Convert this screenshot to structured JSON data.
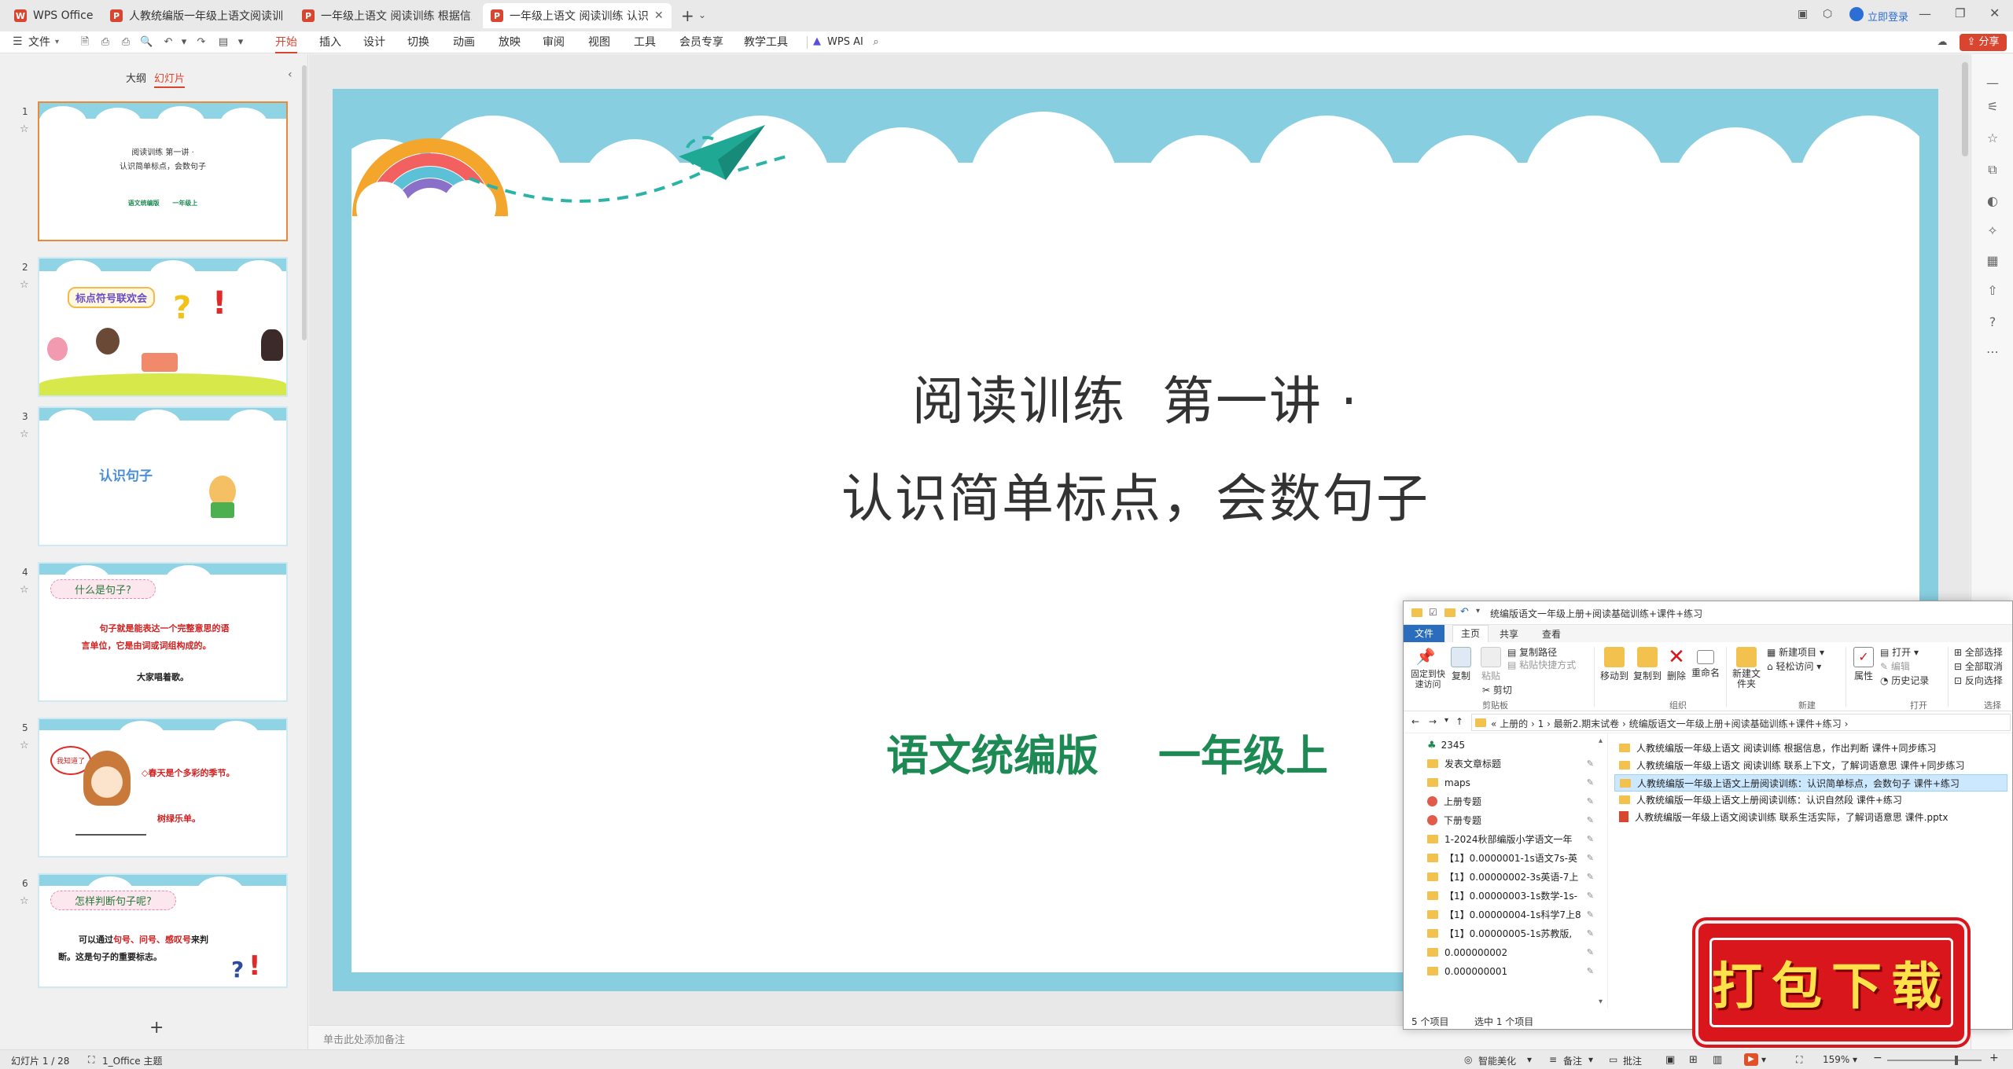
{
  "tabs": [
    {
      "label": "WPS Office",
      "icon": "wps-logo-icon"
    },
    {
      "label": "人教统编版一年级上语文阅读训练 联",
      "icon": "ppt-icon"
    },
    {
      "label": "一年级上语文 阅读训练 根据信息，作",
      "icon": "ppt-icon"
    },
    {
      "label": "一年级上语文 阅读训练 认识简",
      "icon": "ppt-icon"
    }
  ],
  "tabbar": {
    "new_tab": "+",
    "login": "立即登录"
  },
  "menubar": {
    "file": "文件",
    "items": [
      "开始",
      "插入",
      "设计",
      "切换",
      "动画",
      "放映",
      "审阅",
      "视图",
      "工具",
      "会员专享",
      "教学工具"
    ],
    "wps_ai": "WPS AI",
    "share": "分享"
  },
  "panel": {
    "outline_tab": "大纲",
    "slides_tab": "幻灯片",
    "add": "+"
  },
  "thumbnails": [
    {
      "num": "1",
      "line1": "阅读训练  第一讲 ·",
      "line2": "认识简单标点，会数句子",
      "green": "语文统编版      一年级上"
    },
    {
      "num": "2",
      "title": "标点符号联欢会"
    },
    {
      "num": "3",
      "title": "认识句子"
    },
    {
      "num": "4",
      "bubble": "什么是句子?",
      "body1": "句子就是能表达一个完整意思的语",
      "body2": "言单位，它是由词或词组构成的。",
      "example": "大家唱着歌。"
    },
    {
      "num": "5",
      "bubble": "我知道了",
      "body1": "◇春天是个多彩的季节。",
      "example": "树绿乐单。"
    },
    {
      "num": "6",
      "bubble": "怎样判断句子呢?",
      "body1a": "可以通过",
      "body1b": "句号、问号、感叹号",
      "body1c": "来判",
      "body2": "断。这是句子的重要标志。"
    }
  ],
  "slide": {
    "title1": "阅读训练  第一讲 ·",
    "title2": "认识简单标点，会数句子",
    "edition": "语文统编版",
    "grade": "一年级上"
  },
  "notes_placeholder": "单击此处添加备注",
  "status": {
    "slide_counter": "幻灯片 1 / 28",
    "theme": "1_Office 主题",
    "beautify": "智能美化",
    "notes": "备注",
    "comments": "批注",
    "zoom": "159%"
  },
  "explorer": {
    "title": "统编版语文一年级上册+阅读基础训练+课件+练习",
    "tabs": [
      "文件",
      "主页",
      "共享",
      "查看"
    ],
    "ribbon": {
      "pin": "固定到快速访问",
      "copy": "复制",
      "paste": "粘贴",
      "copy_path": "复制路径",
      "paste_shortcut": "粘贴快捷方式",
      "cut": "剪切",
      "move_to": "移动到",
      "copy_to": "复制到",
      "delete": "删除",
      "rename": "重命名",
      "new_folder": "新建文件夹",
      "new_item": "新建项目",
      "easy_access": "轻松访问",
      "properties": "属性",
      "open": "打开",
      "edit": "编辑",
      "history": "历史记录",
      "select_all": "全部选择",
      "select_none": "全部取消",
      "invert": "反向选择",
      "group_clipboard": "剪贴板",
      "group_organize": "组织",
      "group_new": "新建",
      "group_open": "打开",
      "group_select": "选择"
    },
    "address": [
      "上册的",
      "1",
      "最新2.期末试卷",
      "统编版语文一年级上册+阅读基础训练+课件+练习"
    ],
    "nav": [
      {
        "label": "2345",
        "type": "green"
      },
      {
        "label": "发表文章标题",
        "type": "folder"
      },
      {
        "label": "maps",
        "type": "folder"
      },
      {
        "label": "上册专题",
        "type": "red"
      },
      {
        "label": "下册专题",
        "type": "red"
      },
      {
        "label": "1-2024秋部编版小学语文一年",
        "type": "folder"
      },
      {
        "label": "【1】0.0000001-1s语文7s-英",
        "type": "folder"
      },
      {
        "label": "【1】0.00000002-3s英语-7上",
        "type": "folder"
      },
      {
        "label": "【1】0.00000003-1s数学-1s-",
        "type": "folder"
      },
      {
        "label": "【1】0.00000004-1s科学7上8",
        "type": "folder"
      },
      {
        "label": "【1】0.00000005-1s苏教版,",
        "type": "folder"
      },
      {
        "label": "0.000000002",
        "type": "folder"
      },
      {
        "label": "0.000000001",
        "type": "folder"
      }
    ],
    "files": [
      {
        "name": "人教统编版一年级上语文 阅读训练 根据信息，作出判断   课件+同步练习",
        "type": "folder"
      },
      {
        "name": "人教统编版一年级上语文 阅读训练 联系上下文，了解词语意思   课件+同步练习",
        "type": "folder"
      },
      {
        "name": "人教统编版一年级上语文上册阅读训练：认识简单标点，会数句子  课件+练习",
        "type": "folder",
        "selected": true
      },
      {
        "name": "人教统编版一年级上语文上册阅读训练：认识自然段  课件+练习",
        "type": "folder"
      },
      {
        "name": "人教统编版一年级上语文阅读训练 联系生活实际，了解词语意思  课件.pptx",
        "type": "pptx"
      }
    ],
    "status_count": "5 个项目",
    "status_selected": "选中 1 个项目"
  },
  "download_badge": "打包下载",
  "colors": {
    "accent": "#d9452f",
    "slide_frame": "#87cfe0",
    "green_text": "#1d8a54",
    "badge_red": "#d8161b"
  }
}
